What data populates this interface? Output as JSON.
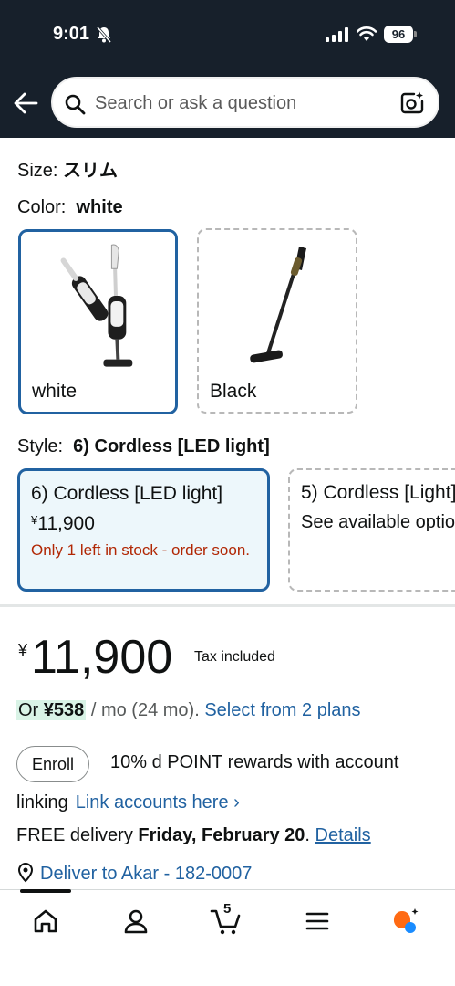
{
  "status_bar": {
    "time": "9:01",
    "battery": "96"
  },
  "search": {
    "placeholder": "Search or ask a question"
  },
  "size": {
    "label": "Size:",
    "value": "スリム"
  },
  "color": {
    "label": "Color:",
    "value": "white",
    "options": [
      {
        "label": "white"
      },
      {
        "label": "Black"
      }
    ]
  },
  "style": {
    "label": "Style:",
    "value": "6) Cordless [LED light]",
    "options": [
      {
        "title": "6) Cordless [LED light]",
        "currency": "¥",
        "price": "11,900",
        "stock": "Only 1 left in stock - order soon."
      },
      {
        "title": "5) Cordless [Light]",
        "subtitle": "See available options"
      }
    ]
  },
  "price": {
    "currency": "¥",
    "amount": "11,900",
    "tax_note": "Tax included"
  },
  "installment": {
    "prefix": "Or ",
    "amount": "¥538",
    "suffix": " / mo (24 mo). ",
    "link": "Select from 2 plans"
  },
  "rewards": {
    "enroll_label": "Enroll",
    "text": "10% d POINT rewards with account",
    "text2": "linking",
    "link": "Link accounts here ›"
  },
  "delivery": {
    "prefix": "FREE delivery ",
    "date": "Friday, February 20",
    "sep": ". ",
    "link": "Details"
  },
  "deliver_to": {
    "text": "Deliver to Akar -  182-0007"
  },
  "cart": {
    "count": "5"
  },
  "colors": {
    "header_bg": "#17202b",
    "accent_blue": "#2162a1",
    "selected_bg": "#edf7fb",
    "stock_red": "#b12704",
    "installment_bg": "#d9f3e6"
  }
}
